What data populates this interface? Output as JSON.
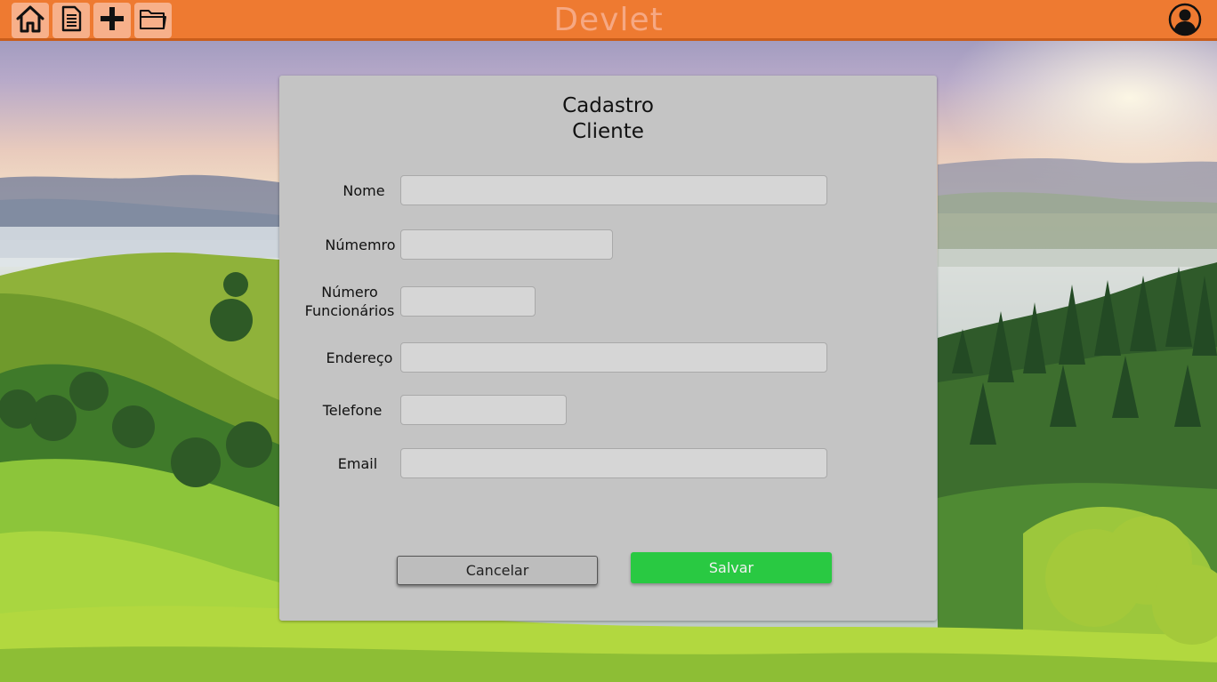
{
  "app": {
    "title": "Devlet"
  },
  "toolbar": {
    "buttons": [
      {
        "icon": "home-icon"
      },
      {
        "icon": "document-icon"
      },
      {
        "icon": "plus-icon"
      },
      {
        "icon": "folder-icon"
      }
    ],
    "user_icon": "user-account-icon",
    "color": "#ee7a31"
  },
  "form": {
    "title_line1": "Cadastro",
    "title_line2": "Cliente",
    "fields": {
      "nome": {
        "label": "Nome",
        "value": "",
        "placeholder": ""
      },
      "numero": {
        "label": "Númemro",
        "value": "",
        "placeholder": ""
      },
      "num_func_line1": "Número",
      "num_func_line2": "Funcionários",
      "num_func": {
        "value": "",
        "placeholder": ""
      },
      "endereco": {
        "label": "Endereço",
        "value": "",
        "placeholder": ""
      },
      "telefone": {
        "label": "Telefone",
        "value": "",
        "placeholder": ""
      },
      "email": {
        "label": "Email",
        "value": "",
        "placeholder": ""
      }
    },
    "buttons": {
      "cancel_label": "Cancelar",
      "save_label": "Salvar"
    },
    "colors": {
      "panel": "#c4c4c4",
      "save": "#29c942"
    }
  }
}
